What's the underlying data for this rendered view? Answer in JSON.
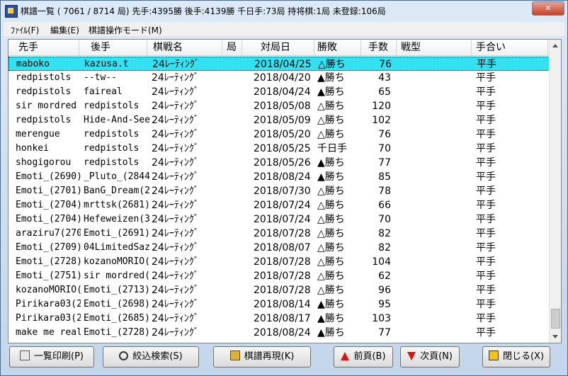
{
  "window": {
    "title": "棋譜一覧 ( 7061 / 8714 局) 先手:4395勝 後手:4139勝 千日手:73局 持将棋:1局 未登録:106局"
  },
  "menu": [
    "ﾌｧｲﾙ(F)",
    "編集(E)",
    "棋譜操作モード(M)"
  ],
  "columns": [
    "先手",
    "後手",
    "棋戦名",
    "局",
    "対局日",
    "勝敗",
    "手数",
    "戦型",
    "手合い"
  ],
  "rows": [
    {
      "sente": "maboko",
      "gote": "kazusa.t",
      "kisen": "24ﾚｰﾃｨﾝｸﾞ",
      "kyoku": "",
      "date": "2018/04/25",
      "result": "△勝ち",
      "moves": "76",
      "senkei": "",
      "teai": "平手"
    },
    {
      "sente": "redpistols",
      "gote": "--tw--",
      "kisen": "24ﾚｰﾃｨﾝｸﾞ",
      "kyoku": "",
      "date": "2018/04/20",
      "result": "▲勝ち",
      "moves": "43",
      "senkei": "",
      "teai": "平手"
    },
    {
      "sente": "redpistols",
      "gote": "faireal",
      "kisen": "24ﾚｰﾃｨﾝｸﾞ",
      "kyoku": "",
      "date": "2018/04/24",
      "result": "▲勝ち",
      "moves": "65",
      "senkei": "",
      "teai": "平手"
    },
    {
      "sente": "sir mordred",
      "gote": "redpistols",
      "kisen": "24ﾚｰﾃｨﾝｸﾞ",
      "kyoku": "",
      "date": "2018/05/08",
      "result": "△勝ち",
      "moves": "120",
      "senkei": "",
      "teai": "平手"
    },
    {
      "sente": "redpistols",
      "gote": "Hide-And-See",
      "kisen": "24ﾚｰﾃｨﾝｸﾞ",
      "kyoku": "",
      "date": "2018/05/09",
      "result": "△勝ち",
      "moves": "102",
      "senkei": "",
      "teai": "平手"
    },
    {
      "sente": "merengue",
      "gote": "redpistols",
      "kisen": "24ﾚｰﾃｨﾝｸﾞ",
      "kyoku": "",
      "date": "2018/05/20",
      "result": "△勝ち",
      "moves": "76",
      "senkei": "",
      "teai": "平手"
    },
    {
      "sente": "honkei",
      "gote": "redpistols",
      "kisen": "24ﾚｰﾃｨﾝｸﾞ",
      "kyoku": "",
      "date": "2018/05/25",
      "result": "千日手",
      "moves": "70",
      "senkei": "",
      "teai": "平手"
    },
    {
      "sente": "shogigorou",
      "gote": "redpistols",
      "kisen": "24ﾚｰﾃｨﾝｸﾞ",
      "kyoku": "",
      "date": "2018/05/26",
      "result": "▲勝ち",
      "moves": "77",
      "senkei": "",
      "teai": "平手"
    },
    {
      "sente": "Emoti_(2690)",
      "gote": "_Pluto_(2844",
      "kisen": "24ﾚｰﾃｨﾝｸﾞ",
      "kyoku": "",
      "date": "2018/08/24",
      "result": "▲勝ち",
      "moves": "85",
      "senkei": "",
      "teai": "平手"
    },
    {
      "sente": "Emoti_(2701)",
      "gote": "BanG_Dream(2",
      "kisen": "24ﾚｰﾃｨﾝｸﾞ",
      "kyoku": "",
      "date": "2018/07/30",
      "result": "△勝ち",
      "moves": "78",
      "senkei": "",
      "teai": "平手"
    },
    {
      "sente": "Emoti_(2704)",
      "gote": "mrttsk(2681)",
      "kisen": "24ﾚｰﾃｨﾝｸﾞ",
      "kyoku": "",
      "date": "2018/07/24",
      "result": "△勝ち",
      "moves": "66",
      "senkei": "",
      "teai": "平手"
    },
    {
      "sente": "Emoti_(2704)",
      "gote": "Hefeweizen(3",
      "kisen": "24ﾚｰﾃｨﾝｸﾞ",
      "kyoku": "",
      "date": "2018/07/24",
      "result": "△勝ち",
      "moves": "70",
      "senkei": "",
      "teai": "平手"
    },
    {
      "sente": "araziru7(270",
      "gote": "Emoti_(2691)",
      "kisen": "24ﾚｰﾃｨﾝｸﾞ",
      "kyoku": "",
      "date": "2018/07/28",
      "result": "△勝ち",
      "moves": "82",
      "senkei": "",
      "teai": "平手"
    },
    {
      "sente": "Emoti_(2709)",
      "gote": "04LimitedSaz",
      "kisen": "24ﾚｰﾃｨﾝｸﾞ",
      "kyoku": "",
      "date": "2018/08/07",
      "result": "△勝ち",
      "moves": "82",
      "senkei": "",
      "teai": "平手"
    },
    {
      "sente": "Emoti_(2728)",
      "gote": "kozanoMORIO(",
      "kisen": "24ﾚｰﾃｨﾝｸﾞ",
      "kyoku": "",
      "date": "2018/07/28",
      "result": "△勝ち",
      "moves": "104",
      "senkei": "",
      "teai": "平手"
    },
    {
      "sente": "Emoti_(2751)",
      "gote": "sir mordred(",
      "kisen": "24ﾚｰﾃｨﾝｸﾞ",
      "kyoku": "",
      "date": "2018/07/28",
      "result": "△勝ち",
      "moves": "62",
      "senkei": "",
      "teai": "平手"
    },
    {
      "sente": "kozanoMORIO(",
      "gote": "Emoti_(2713)",
      "kisen": "24ﾚｰﾃｨﾝｸﾞ",
      "kyoku": "",
      "date": "2018/07/28",
      "result": "△勝ち",
      "moves": "96",
      "senkei": "",
      "teai": "平手"
    },
    {
      "sente": "Pirikara03(2",
      "gote": "Emoti_(2698)",
      "kisen": "24ﾚｰﾃｨﾝｸﾞ",
      "kyoku": "",
      "date": "2018/08/14",
      "result": "▲勝ち",
      "moves": "95",
      "senkei": "",
      "teai": "平手"
    },
    {
      "sente": "Pirikara03(2",
      "gote": "Emoti_(2685)",
      "kisen": "24ﾚｰﾃｨﾝｸﾞ",
      "kyoku": "",
      "date": "2018/08/17",
      "result": "▲勝ち",
      "moves": "103",
      "senkei": "",
      "teai": "平手"
    },
    {
      "sente": "make me real",
      "gote": "Emoti_(2728)",
      "kisen": "24ﾚｰﾃｨﾝｸﾞ",
      "kyoku": "",
      "date": "2018/08/24",
      "result": "▲勝ち",
      "moves": "77",
      "senkei": "",
      "teai": "平手"
    }
  ],
  "selected_row": 0,
  "buttons": {
    "print": "一覧印刷(P)",
    "search": "絞込検索(S)",
    "replay": "棋譜再現(K)",
    "prev": "前頁(B)",
    "next": "次頁(N)",
    "close": "閉じる(X)"
  },
  "colors": {
    "selection": "#33e1f0",
    "arrow": "#dd1111"
  }
}
